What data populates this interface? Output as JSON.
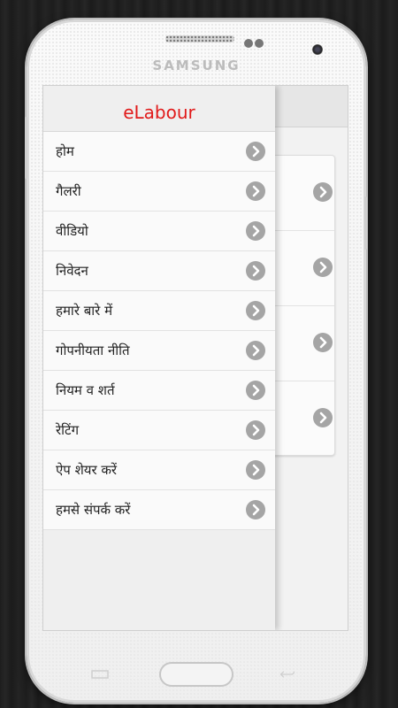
{
  "device": {
    "brand": "SAMSUNG"
  },
  "app": {
    "title": "eLabour",
    "title_color": "#e11a1a"
  },
  "drawer": {
    "items": [
      {
        "label": "होम"
      },
      {
        "label": "गैलरी"
      },
      {
        "label": "वीडियो"
      },
      {
        "label": "निवेदन"
      },
      {
        "label": "हमारे बारे में"
      },
      {
        "label": "गोपनीयता नीति"
      },
      {
        "label": "नियम व शर्त"
      },
      {
        "label": "रेटिंग"
      },
      {
        "label": "ऐप शेयर करें"
      },
      {
        "label": "हमसे संपर्क करें"
      }
    ]
  },
  "icons": {
    "menu_item_arrow": "chevron-right-icon",
    "background_row_arrow": "chevron-right-icon"
  }
}
